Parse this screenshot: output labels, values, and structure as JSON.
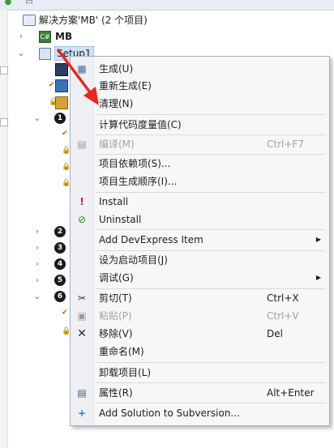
{
  "tree": {
    "solution_label": "解决方案'MB' (2 个项目)",
    "project_mb": "MB",
    "project_setup": "Setup1",
    "numbered_nodes": [
      "1",
      "2",
      "3",
      "4",
      "5",
      "6"
    ]
  },
  "context_menu": {
    "items": [
      {
        "label": "生成(U)",
        "shortcut": "",
        "icon": "build-icon"
      },
      {
        "label": "重新生成(E)",
        "shortcut": "",
        "icon": ""
      },
      {
        "label": "清理(N)",
        "shortcut": "",
        "icon": ""
      },
      {
        "label": "计算代码度量值(C)",
        "shortcut": "",
        "icon": ""
      },
      {
        "label": "编译(M)",
        "shortcut": "Ctrl+F7",
        "icon": "compile-icon",
        "disabled": true
      },
      {
        "label": "项目依赖项(S)...",
        "shortcut": "",
        "icon": ""
      },
      {
        "label": "项目生成顺序(I)...",
        "shortcut": "",
        "icon": ""
      },
      {
        "label": "Install",
        "shortcut": "",
        "icon": "exclamation-icon"
      },
      {
        "label": "Uninstall",
        "shortcut": "",
        "icon": "uninstall-icon"
      },
      {
        "label": "Add DevExpress Item",
        "shortcut": "",
        "icon": "",
        "submenu": true
      },
      {
        "label": "设为启动项目(J)",
        "shortcut": "",
        "icon": ""
      },
      {
        "label": "调试(G)",
        "shortcut": "",
        "icon": "",
        "submenu": true
      },
      {
        "label": "剪切(T)",
        "shortcut": "Ctrl+X",
        "icon": "scissors-icon"
      },
      {
        "label": "粘贴(P)",
        "shortcut": "Ctrl+V",
        "icon": "paste-icon",
        "disabled": true
      },
      {
        "label": "移除(V)",
        "shortcut": "Del",
        "icon": "remove-icon"
      },
      {
        "label": "重命名(M)",
        "shortcut": "",
        "icon": ""
      },
      {
        "label": "卸载项目(L)",
        "shortcut": "",
        "icon": ""
      },
      {
        "label": "属性(R)",
        "shortcut": "Alt+Enter",
        "icon": "properties-icon"
      },
      {
        "label": "Add Solution to Subversion...",
        "shortcut": "",
        "icon": "plus-icon"
      }
    ]
  },
  "colors": {
    "menu_background": "#f6f7f9",
    "annotation_arrow": "#e8281e",
    "selection": "#cde2f7"
  }
}
